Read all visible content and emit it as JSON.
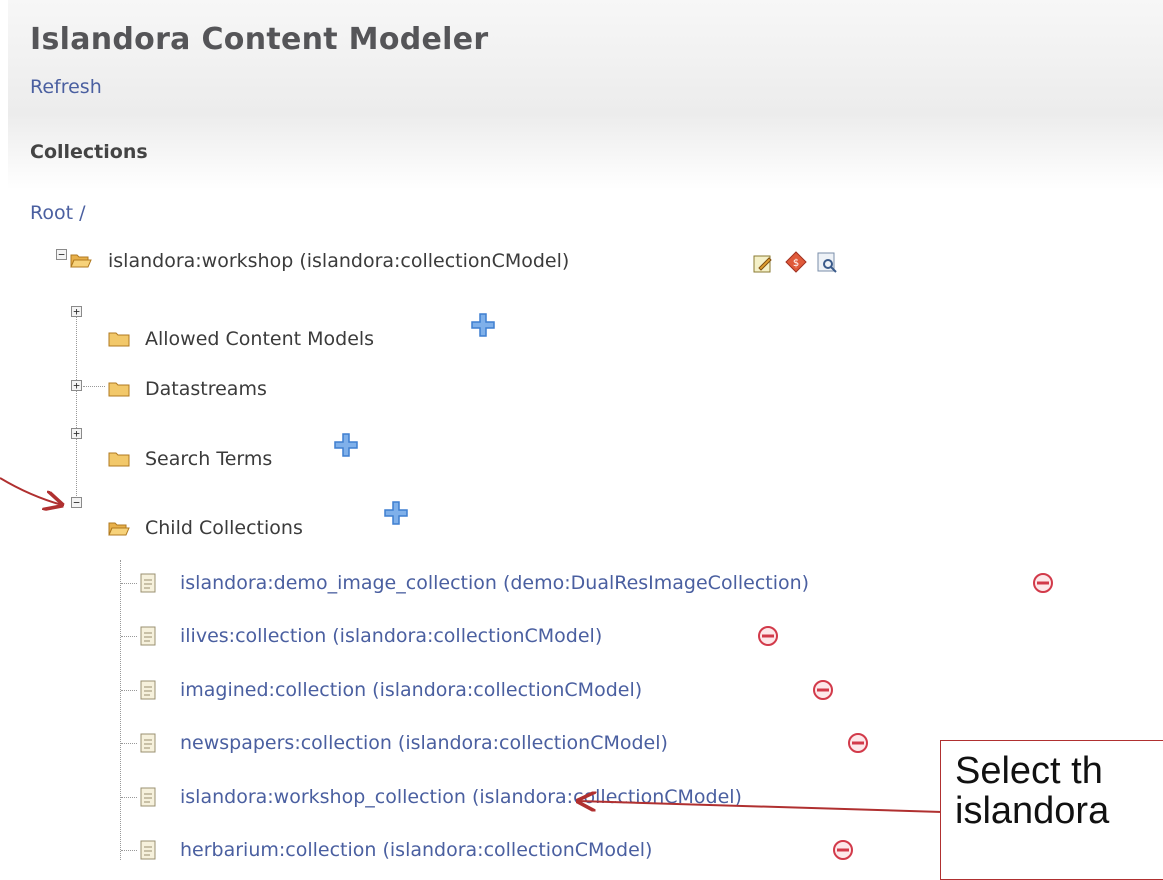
{
  "app": {
    "title": "Islandora Content Modeler",
    "refresh_label": "Refresh",
    "collections_heading": "Collections",
    "root_label": "Root /"
  },
  "tree": {
    "root_node": "islandora:workshop (islandora:collectionCModel)",
    "root_node_icons": [
      "edit-icon",
      "delete-icon",
      "view-icon"
    ],
    "folders": [
      {
        "label": "Allowed Content Models",
        "expander": "+",
        "addable": true
      },
      {
        "label": "Datastreams",
        "expander": "+",
        "addable": false
      },
      {
        "label": "Search Terms",
        "expander": "+",
        "addable": true
      },
      {
        "label": "Child Collections",
        "expander": "−",
        "addable": true
      }
    ],
    "children": [
      "islandora:demo_image_collection (demo:DualResImageCollection)",
      "ilives:collection (islandora:collectionCModel)",
      "imagined:collection (islandora:collectionCModel)",
      "newspapers:collection (islandora:collectionCModel)",
      "islandora:workshop_collection (islandora:collectionCModel)",
      "herbarium:collection (islandora:collectionCModel)"
    ]
  },
  "callout": {
    "line1": "Select th",
    "line2": "islandora"
  },
  "colors": {
    "link": "#4a5fa0",
    "folder": "#e8b04a",
    "plus": "#3f7fd0",
    "remove": "#d23a4a",
    "annotation": "#b03030"
  }
}
